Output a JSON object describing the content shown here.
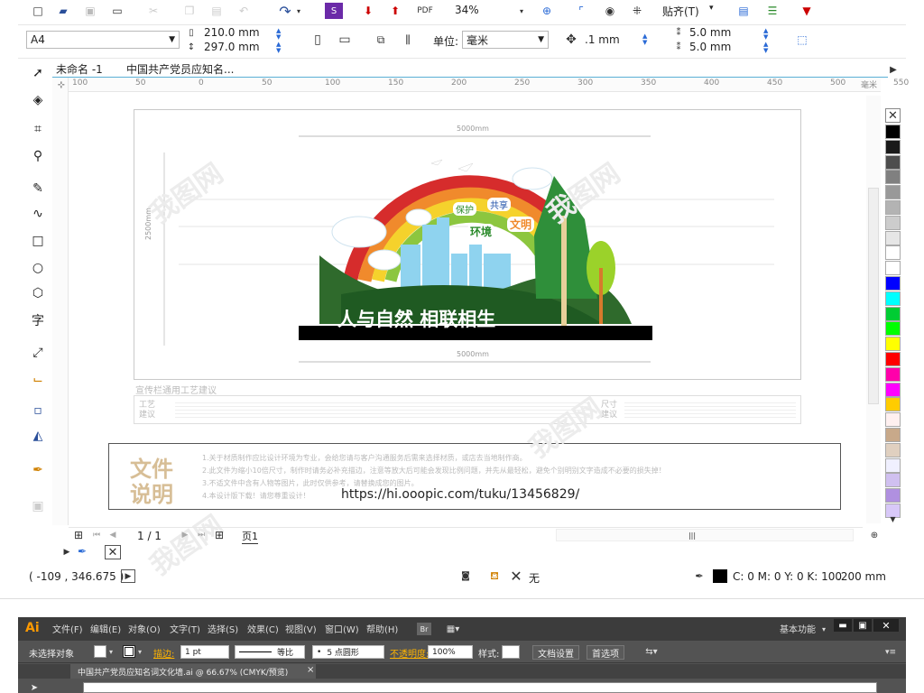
{
  "toolbar": {
    "zoom": "34%",
    "snap_label": "贴齐(T)",
    "snap_arrow": "▾",
    "page_size": "A4",
    "width": "210.0 mm",
    "height": "297.0 mm",
    "units_label": "单位:",
    "units_value": "毫米",
    "nudge": ".1 mm",
    "dup_x": "5.0 mm",
    "dup_y": "5.0 mm"
  },
  "tabs": [
    {
      "label": "未命名 -1"
    },
    {
      "label": "中国共产党员应知名..."
    }
  ],
  "ruler": {
    "ticks": [
      "100",
      "50",
      "0",
      "50",
      "100",
      "150",
      "200",
      "250",
      "300",
      "350",
      "400",
      "450",
      "500",
      "550"
    ],
    "unit": "毫米"
  },
  "design": {
    "top_dim": "5000mm",
    "bottom_dim": "5000mm",
    "side_dim": "2500mm",
    "slogan": "人与自然 相联相生",
    "bubbles": [
      "保护",
      "共享",
      "文明",
      "环境"
    ],
    "section_title": "宣传栏通用工艺建议",
    "craft_label": "工艺建议",
    "size_label": "尺寸建议"
  },
  "info_box": {
    "title1": "文件",
    "title2": "说明",
    "lines": [
      "1.关于材质制作应比设计环境为专业，会给您请与客户沟通服务后需来选择材质，或店去当地制作商。",
      "2.此文件为缩小10倍尺寸，制作时请务必补充描边，注意等放大后可能会发现比例问题，并先从最轻松，避免个别明别文字造成不必要的损失掉！",
      "3.不适文件中含有人物等图片，此时仅供参考，请替换成您的图片。",
      "4.本设计版下载！请您尊重设计！"
    ],
    "url": "https://hi.ooopic.com/tuku/13456829/"
  },
  "navigator": {
    "page_counter": "1 / 1",
    "page_tab": "页1"
  },
  "status": {
    "coords": "( -109 , 346.675 )",
    "fill_label": "无",
    "color_info": "C: 0 M: 0 Y: 0 K: 100",
    "outline": ".200 mm"
  },
  "palette": [
    "#000000",
    "#1a1a1a",
    "#4d4d4d",
    "#808080",
    "#999999",
    "#b3b3b3",
    "#cccccc",
    "#e6e6e6",
    "#ffffff",
    "#ffffff",
    "#0000ff",
    "#00ffff",
    "#00cc33",
    "#00ff00",
    "#ffff00",
    "#ff0000",
    "#ff00aa",
    "#ff00ff",
    "#ffcc00",
    "#fff0f0",
    "#c8a98a",
    "#e0d0c0",
    "#f0f0ff",
    "#d0c0f0",
    "#b090e0",
    "#d8c8f8"
  ],
  "illustrator": {
    "logo": "Ai",
    "menus": [
      "文件(F)",
      "编辑(E)",
      "对象(O)",
      "文字(T)",
      "选择(S)",
      "效果(C)",
      "视图(V)",
      "窗口(W)",
      "帮助(H)"
    ],
    "workspace": "基本功能",
    "control": {
      "no_selection": "未选择对象",
      "stroke_label": "描边:",
      "stroke_value": "1 pt",
      "stroke_style": "等比",
      "brush": "5 点圆形",
      "opacity_label": "不透明度:",
      "opacity_value": "100%",
      "style_label": "样式:",
      "doc_settings": "文档设置",
      "prefs": "首选项"
    },
    "doc_tab": "中国共产党员应知名词文化墙.ai @ 66.67% (CMYK/预览)",
    "close": "×"
  },
  "colors": {
    "accent": "#2a6ad6",
    "ai_bg": "#535353",
    "ai_menu_bg": "#3c3c3c",
    "ai_logo": "#ff9a00"
  }
}
